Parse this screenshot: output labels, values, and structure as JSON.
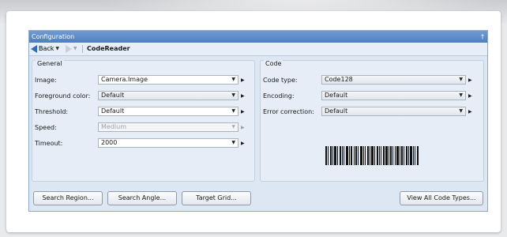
{
  "window": {
    "title": "Configuration",
    "pin_glyph": "†"
  },
  "toolbar": {
    "back_label": "Back",
    "breadcrumb": "CodeReader"
  },
  "general": {
    "title": "General",
    "rows": [
      {
        "label": "Image:",
        "value": "Camera.Image"
      },
      {
        "label": "Foreground color:",
        "value": "Default"
      },
      {
        "label": "Threshold:",
        "value": "Default"
      },
      {
        "label": "Speed:",
        "value": "Medium"
      },
      {
        "label": "Timeout:",
        "value": "2000"
      }
    ]
  },
  "code": {
    "title": "Code",
    "rows": [
      {
        "label": "Code type:",
        "value": "Code128"
      },
      {
        "label": "Encoding:",
        "value": "Default"
      },
      {
        "label": "Error correction:",
        "value": "Default"
      }
    ]
  },
  "buttons": {
    "search_region": "Search Region...",
    "search_angle": "Search Angle...",
    "target_grid": "Target Grid...",
    "view_all": "View All Code Types..."
  },
  "glyphs": {
    "dropdown": "▼",
    "side": "▶"
  },
  "colors": {
    "titlebar": "#4f7fbd",
    "panel_bg": "#dde7f3",
    "back_arrow": "#2e6db8"
  }
}
